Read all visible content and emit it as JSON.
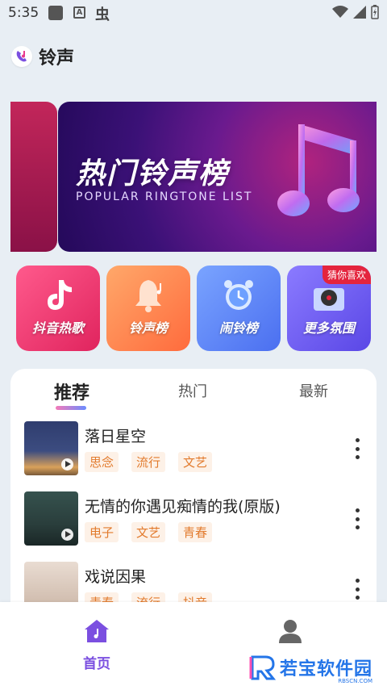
{
  "status_bar": {
    "time": "5:35",
    "extra_glyph": "虫"
  },
  "header": {
    "title": "铃声"
  },
  "banner": {
    "title": "热门铃声榜",
    "subtitle": "POPULAR RINGTONE LIST"
  },
  "categories": [
    {
      "label": "抖音热歌"
    },
    {
      "label": "铃声榜"
    },
    {
      "label": "闹铃榜"
    },
    {
      "label": "更多氛围",
      "badge": "猜你喜欢"
    }
  ],
  "tabs": [
    {
      "label": "推荐",
      "active": true
    },
    {
      "label": "热门",
      "active": false
    },
    {
      "label": "最新",
      "active": false
    }
  ],
  "songs": [
    {
      "title": "落日星空",
      "tags": [
        "思念",
        "流行",
        "文艺"
      ]
    },
    {
      "title": "无情的你遇见痴情的我(原版)",
      "tags": [
        "电子",
        "文艺",
        "青春"
      ]
    },
    {
      "title": "戏说因果",
      "tags": [
        "青春",
        "流行",
        "抖音"
      ]
    }
  ],
  "bottom_nav": {
    "home_label": "首页"
  },
  "watermark": {
    "text": "若宝软件园",
    "sub": "RBSCN.COM"
  },
  "colors": {
    "accent": "#7b4fe0",
    "tag_text": "#e27a2c",
    "tag_bg": "#fdf1e7",
    "badge": "#e4243d"
  }
}
